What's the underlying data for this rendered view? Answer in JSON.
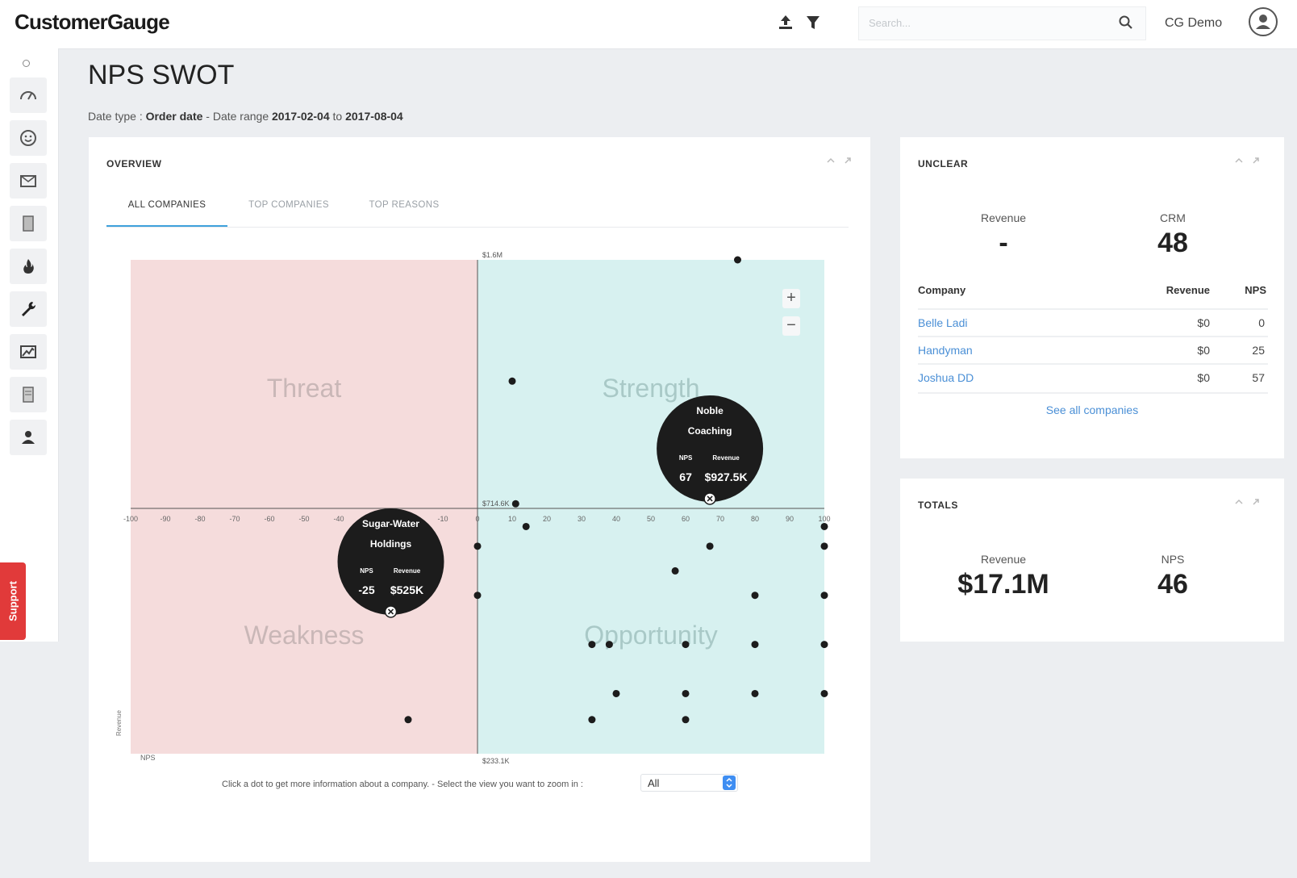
{
  "app": {
    "logo": "CustomerGauge",
    "search_placeholder": "Search...",
    "user_name": "CG Demo",
    "support_label": "Support"
  },
  "page": {
    "title": "NPS SWOT",
    "date_type_label": "Date type :",
    "date_type_value": "Order date",
    "date_range_label": "- Date range",
    "date_from": "2017-02-04",
    "date_to_label": "to",
    "date_to": "2017-08-04"
  },
  "overview": {
    "title": "OVERVIEW",
    "tabs": [
      "ALL COMPANIES",
      "TOP COMPANIES",
      "TOP REASONS"
    ],
    "active_tab": 0,
    "helper_text": "Click a dot to get more information about a company. - Select the view you want to zoom in :",
    "zoom_value": "All"
  },
  "chart_data": {
    "type": "scatter",
    "quadrants": [
      "Threat",
      "Strength",
      "Weakness",
      "Opportunity"
    ],
    "x_ticks": [
      -100,
      -90,
      -80,
      -70,
      -60,
      -50,
      -40,
      -30,
      -20,
      -10,
      0,
      10,
      20,
      30,
      40,
      50,
      60,
      70,
      80,
      90,
      100
    ],
    "xlim": [
      -100,
      100
    ],
    "ylim": [
      233.1,
      1600
    ],
    "y_ticks": [
      1600,
      714.6
    ],
    "y_tick_labels": [
      "$1.6M",
      "$714.6K"
    ],
    "y_min_label": "$233.1K",
    "xlabel": "NPS",
    "ylabel": "Revenue",
    "points": [
      {
        "x": 75,
        "y": 1600
      },
      {
        "x": 10,
        "y": 1168
      },
      {
        "x": 11,
        "y": 731
      },
      {
        "x": 14,
        "y": 650
      },
      {
        "x": 67,
        "y": 927.5
      },
      {
        "x": 100,
        "y": 650
      },
      {
        "x": -25,
        "y": 525
      },
      {
        "x": 0,
        "y": 580
      },
      {
        "x": 67,
        "y": 580
      },
      {
        "x": 100,
        "y": 580
      },
      {
        "x": 57,
        "y": 492
      },
      {
        "x": 0,
        "y": 405
      },
      {
        "x": 80,
        "y": 405
      },
      {
        "x": 100,
        "y": 405
      },
      {
        "x": 33,
        "y": 230
      },
      {
        "x": 38,
        "y": 230
      },
      {
        "x": 60,
        "y": 230
      },
      {
        "x": 80,
        "y": 230
      },
      {
        "x": 100,
        "y": 230
      },
      {
        "x": 40,
        "y": 55
      },
      {
        "x": 60,
        "y": 55
      },
      {
        "x": 80,
        "y": 55
      },
      {
        "x": 100,
        "y": 55
      },
      {
        "x": -20,
        "y": -38
      },
      {
        "x": 33,
        "y": -38
      },
      {
        "x": 60,
        "y": -38
      }
    ],
    "tooltips": [
      {
        "name": [
          "Noble",
          "Coaching"
        ],
        "nps_label": "NPS",
        "revenue_label": "Revenue",
        "nps": 67,
        "revenue": "$927.5K",
        "x": 67,
        "y": 927.5
      },
      {
        "name": [
          "Sugar-Water",
          "Holdings"
        ],
        "nps_label": "NPS",
        "revenue_label": "Revenue",
        "nps": -25,
        "revenue": "$525K",
        "x": -25,
        "y": 525
      }
    ]
  },
  "unclear": {
    "title": "UNCLEAR",
    "revenue_label": "Revenue",
    "revenue_value": "-",
    "crm_label": "CRM",
    "crm_value": "48",
    "columns": [
      "Company",
      "Revenue",
      "NPS"
    ],
    "rows": [
      {
        "company": "Belle Ladi",
        "revenue": "$0",
        "nps": "0"
      },
      {
        "company": "Handyman",
        "revenue": "$0",
        "nps": "25"
      },
      {
        "company": "Joshua DD",
        "revenue": "$0",
        "nps": "57"
      }
    ],
    "see_all": "See all companies"
  },
  "totals": {
    "title": "TOTALS",
    "revenue_label": "Revenue",
    "revenue_value": "$17.1M",
    "nps_label": "NPS",
    "nps_value": "46"
  },
  "colors": {
    "threat_bg": "#f5dcdc",
    "strength_bg": "#d7f1f0",
    "accent": "#3fa1dc",
    "link": "#4a8fd6",
    "support": "#e13a3a"
  }
}
